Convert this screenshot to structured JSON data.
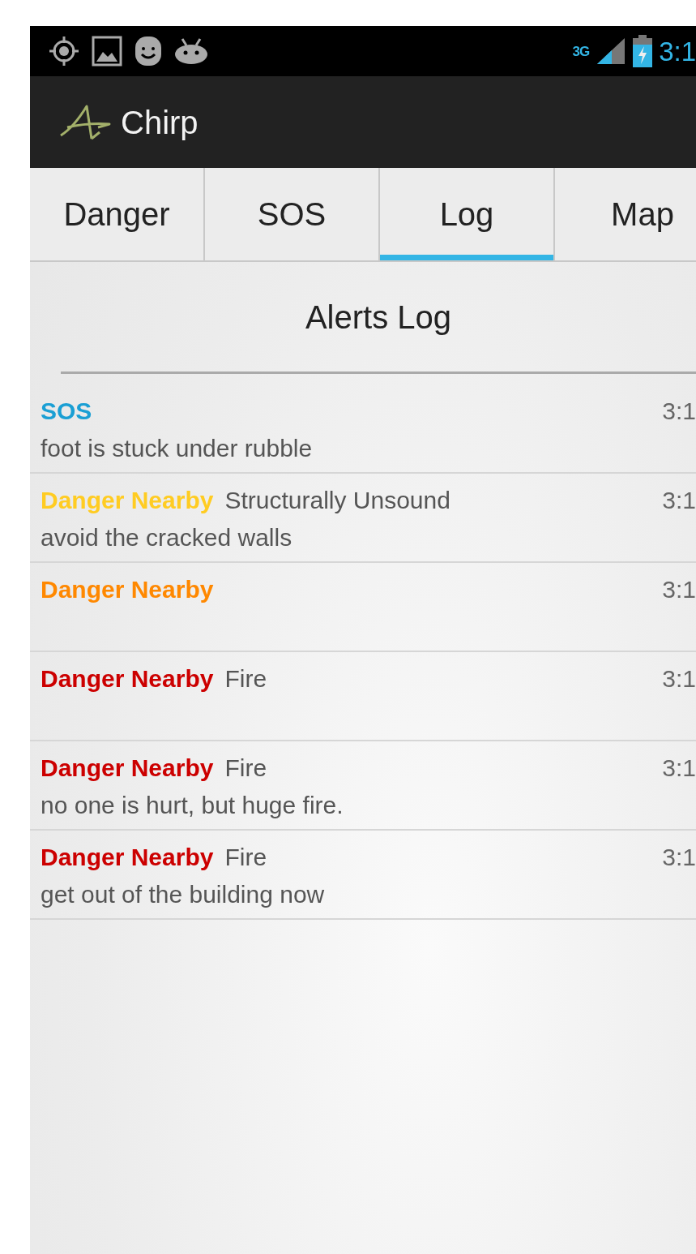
{
  "status_bar": {
    "network": "3G",
    "time": "3:1"
  },
  "app_bar": {
    "title": "Chirp"
  },
  "tabs": [
    {
      "label": "Danger",
      "selected": false
    },
    {
      "label": "SOS",
      "selected": false
    },
    {
      "label": "Log",
      "selected": true
    },
    {
      "label": "Map",
      "selected": false
    }
  ],
  "log": {
    "title": "Alerts Log",
    "alerts": [
      {
        "title": "SOS",
        "color": "#1a9fd4",
        "message": "foot is stuck under rubble",
        "time": "3:1"
      },
      {
        "title": "Danger Nearby",
        "color": "#ffcc22",
        "subtitle": "Structurally Unsound",
        "message": "avoid the cracked walls",
        "time": "3:1"
      },
      {
        "title": "Danger Nearby",
        "color": "#ff8800",
        "time": "3:1"
      },
      {
        "title": "Danger Nearby",
        "color": "#cc0000",
        "subtitle": "Fire",
        "time": "3:1"
      },
      {
        "title": "Danger Nearby",
        "color": "#cc0000",
        "subtitle": "Fire",
        "message": "no one is hurt, but huge fire.",
        "time": "3:1"
      },
      {
        "title": "Danger Nearby",
        "color": "#cc0000",
        "subtitle": "Fire",
        "message": "get out of the building now",
        "time": "3:1"
      }
    ]
  }
}
